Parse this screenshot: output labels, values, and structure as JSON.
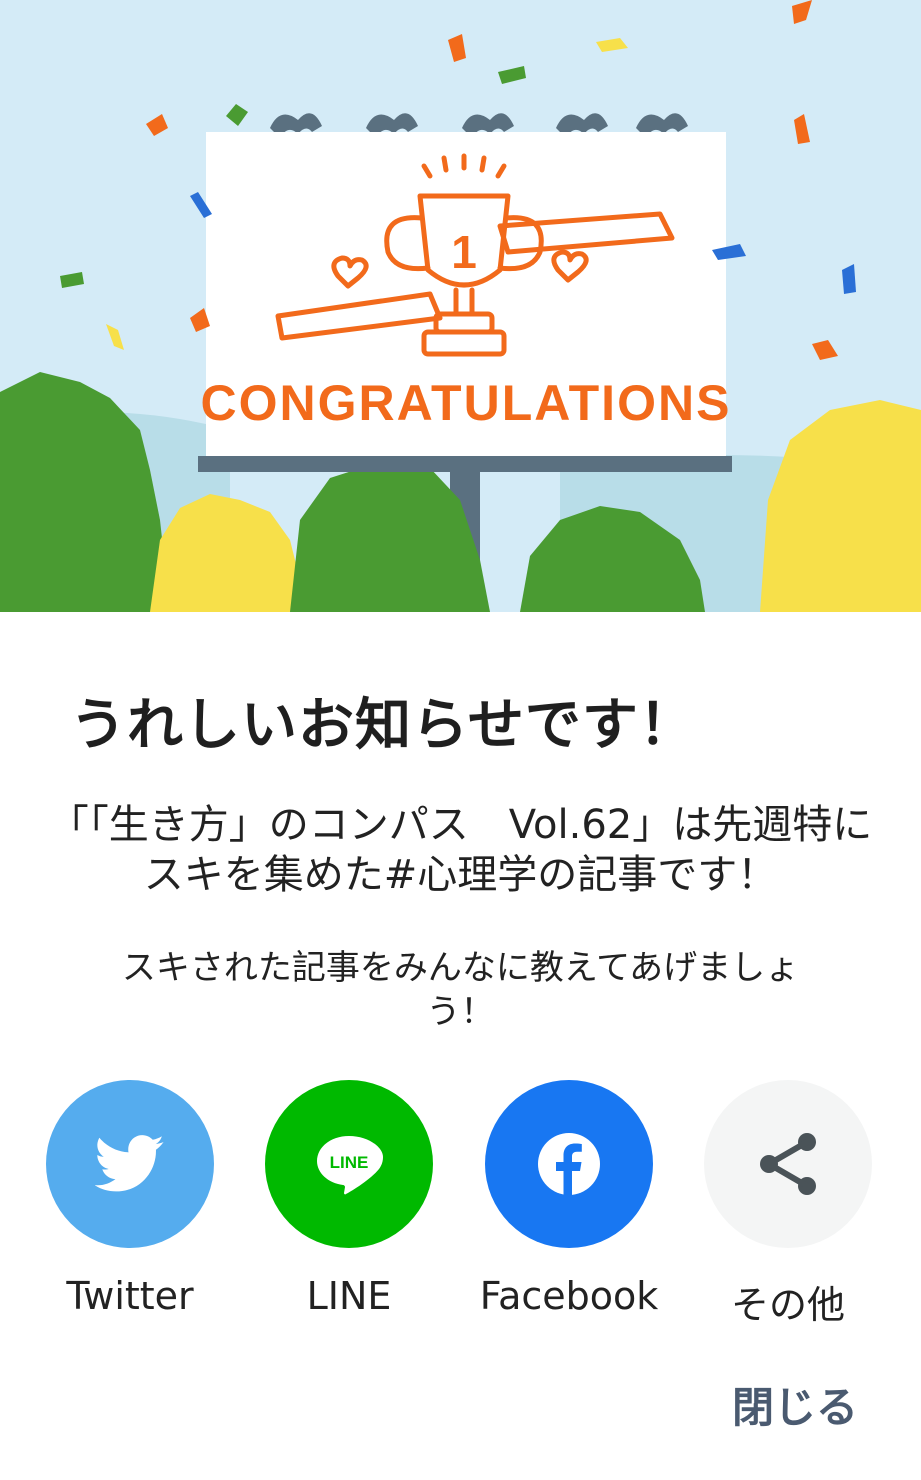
{
  "hero": {
    "billboard_text": "CONGRATULATIONS",
    "trophy_number": "1",
    "colors": {
      "sky": "#d4ebf7",
      "orange": "#f26a1b",
      "green": "#4a9b32",
      "yellow": "#f7e04a",
      "pole": "#5a7080"
    }
  },
  "dialog": {
    "title": "うれしいお知らせです！",
    "description": "「「生き方」のコンパス　Vol.62」は先週特にスキを集めた#心理学の記事です！",
    "subtext": "スキされた記事をみんなに教えてあげましょう！",
    "close_label": "閉じる"
  },
  "share": [
    {
      "label": "Twitter",
      "icon": "twitter-bird-icon",
      "color": "#55acee"
    },
    {
      "label": "LINE",
      "icon": "line-icon",
      "icon_text": "LINE",
      "color": "#00b900"
    },
    {
      "label": "Facebook",
      "icon": "facebook-icon",
      "color": "#1877f2"
    },
    {
      "label": "その他",
      "icon": "share-icon",
      "color": "#f4f5f5"
    }
  ]
}
